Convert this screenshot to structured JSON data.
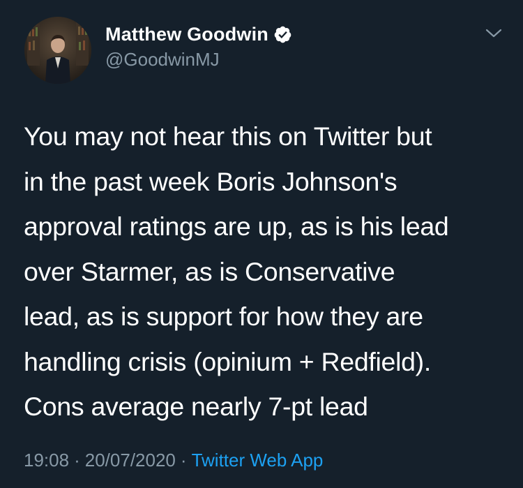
{
  "author": {
    "display_name": "Matthew Goodwin",
    "handle": "@GoodwinMJ",
    "verified": true,
    "avatar_icon": "profile-photo"
  },
  "menu": {
    "icon": "chevron-down-icon"
  },
  "tweet": {
    "lines": [
      "You may not hear this on Twitter but",
      "in the past week Boris Johnson's",
      "approval ratings are up, as is his lead",
      "over Starmer, as is Conservative",
      "lead, as is support for how they are",
      "handling crisis (opinium + Redfield).",
      "Cons average nearly 7-pt lead"
    ]
  },
  "meta": {
    "time": "19:08",
    "separator": "·",
    "date": "20/07/2020",
    "source": "Twitter Web App"
  },
  "colors": {
    "background": "#15202b",
    "text": "#ffffff",
    "secondary_text": "#8899a6",
    "accent": "#1da1f2"
  }
}
